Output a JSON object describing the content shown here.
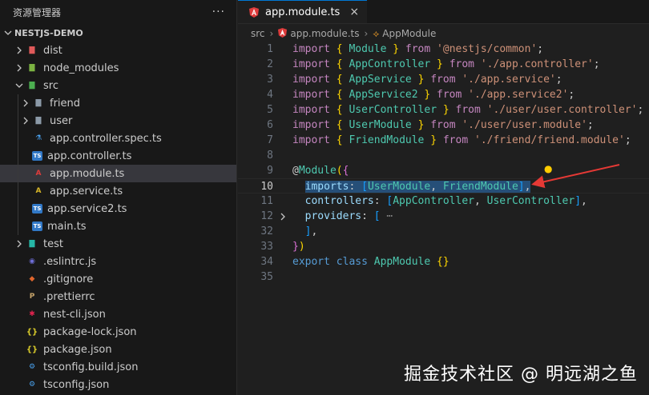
{
  "sidebar": {
    "title": "资源管理器",
    "more": "···",
    "project": "NESTJS-DEMO",
    "items": [
      {
        "label": "dist",
        "icon": "folder-dist-icon",
        "depth": 0,
        "chevron": "right",
        "glyph": "▇"
      },
      {
        "label": "node_modules",
        "icon": "folder-node-icon",
        "depth": 0,
        "chevron": "right",
        "glyph": "▇"
      },
      {
        "label": "src",
        "icon": "folder-src-icon",
        "depth": 0,
        "chevron": "down",
        "glyph": "▇"
      },
      {
        "label": "friend",
        "icon": "folder-icon",
        "depth": 1,
        "chevron": "right",
        "glyph": "▇"
      },
      {
        "label": "user",
        "icon": "folder-icon",
        "depth": 1,
        "chevron": "right",
        "glyph": "▇"
      },
      {
        "label": "app.controller.spec.ts",
        "icon": "test-flask-icon",
        "depth": 1,
        "chevron": "",
        "glyph": "⚗"
      },
      {
        "label": "app.controller.ts",
        "icon": "typescript-icon",
        "depth": 1,
        "chevron": "",
        "glyph": "TS"
      },
      {
        "label": "app.module.ts",
        "icon": "angular-icon",
        "depth": 1,
        "chevron": "",
        "glyph": "A",
        "selected": true
      },
      {
        "label": "app.service.ts",
        "icon": "angular-service-icon",
        "depth": 1,
        "chevron": "",
        "glyph": "A"
      },
      {
        "label": "app.service2.ts",
        "icon": "typescript-icon",
        "depth": 1,
        "chevron": "",
        "glyph": "TS"
      },
      {
        "label": "main.ts",
        "icon": "typescript-icon",
        "depth": 1,
        "chevron": "",
        "glyph": "TS"
      },
      {
        "label": "test",
        "icon": "folder-test-icon",
        "depth": 0,
        "chevron": "right",
        "glyph": "▇"
      },
      {
        "label": ".eslintrc.js",
        "icon": "eslint-icon",
        "depth": 0,
        "chevron": "",
        "glyph": "◉"
      },
      {
        "label": ".gitignore",
        "icon": "git-icon",
        "depth": 0,
        "chevron": "",
        "glyph": "◆"
      },
      {
        "label": ".prettierrc",
        "icon": "prettier-icon",
        "depth": 0,
        "chevron": "",
        "glyph": "P"
      },
      {
        "label": "nest-cli.json",
        "icon": "nest-icon",
        "depth": 0,
        "chevron": "",
        "glyph": "✱"
      },
      {
        "label": "package-lock.json",
        "icon": "json-icon",
        "depth": 0,
        "chevron": "",
        "glyph": "{}"
      },
      {
        "label": "package.json",
        "icon": "json-icon",
        "depth": 0,
        "chevron": "",
        "glyph": "{}"
      },
      {
        "label": "tsconfig.build.json",
        "icon": "tsconfig-icon",
        "depth": 0,
        "chevron": "",
        "glyph": "⚙"
      },
      {
        "label": "tsconfig.json",
        "icon": "tsconfig-icon",
        "depth": 0,
        "chevron": "",
        "glyph": "⚙"
      }
    ]
  },
  "editor": {
    "tab": {
      "label": "app.module.ts",
      "close": "×"
    },
    "breadcrumb": {
      "folder": "src",
      "file": "app.module.ts",
      "symbol": "AppModule"
    },
    "lines": [
      {
        "n": "1",
        "segs": [
          [
            "kw",
            "import"
          ],
          [
            "punc",
            " "
          ],
          [
            "br",
            "{"
          ],
          [
            "punc",
            " "
          ],
          [
            "id",
            "Module"
          ],
          [
            "punc",
            " "
          ],
          [
            "br",
            "}"
          ],
          [
            "punc",
            " "
          ],
          [
            "kw",
            "from"
          ],
          [
            "punc",
            " "
          ],
          [
            "str",
            "'@nestjs/common'"
          ],
          [
            "punc",
            ";"
          ]
        ]
      },
      {
        "n": "2",
        "segs": [
          [
            "kw",
            "import"
          ],
          [
            "punc",
            " "
          ],
          [
            "br",
            "{"
          ],
          [
            "punc",
            " "
          ],
          [
            "id",
            "AppController"
          ],
          [
            "punc",
            " "
          ],
          [
            "br",
            "}"
          ],
          [
            "punc",
            " "
          ],
          [
            "kw",
            "from"
          ],
          [
            "punc",
            " "
          ],
          [
            "str",
            "'./app.controller'"
          ],
          [
            "punc",
            ";"
          ]
        ]
      },
      {
        "n": "3",
        "segs": [
          [
            "kw",
            "import"
          ],
          [
            "punc",
            " "
          ],
          [
            "br",
            "{"
          ],
          [
            "punc",
            " "
          ],
          [
            "id",
            "AppService"
          ],
          [
            "punc",
            " "
          ],
          [
            "br",
            "}"
          ],
          [
            "punc",
            " "
          ],
          [
            "kw",
            "from"
          ],
          [
            "punc",
            " "
          ],
          [
            "str",
            "'./app.service'"
          ],
          [
            "punc",
            ";"
          ]
        ]
      },
      {
        "n": "4",
        "segs": [
          [
            "kw",
            "import"
          ],
          [
            "punc",
            " "
          ],
          [
            "br",
            "{"
          ],
          [
            "punc",
            " "
          ],
          [
            "id",
            "AppService2"
          ],
          [
            "punc",
            " "
          ],
          [
            "br",
            "}"
          ],
          [
            "punc",
            " "
          ],
          [
            "kw",
            "from"
          ],
          [
            "punc",
            " "
          ],
          [
            "str",
            "'./app.service2'"
          ],
          [
            "punc",
            ";"
          ]
        ]
      },
      {
        "n": "5",
        "segs": [
          [
            "kw",
            "import"
          ],
          [
            "punc",
            " "
          ],
          [
            "br",
            "{"
          ],
          [
            "punc",
            " "
          ],
          [
            "id",
            "UserController"
          ],
          [
            "punc",
            " "
          ],
          [
            "br",
            "}"
          ],
          [
            "punc",
            " "
          ],
          [
            "kw",
            "from"
          ],
          [
            "punc",
            " "
          ],
          [
            "str",
            "'./user/user.controller'"
          ],
          [
            "punc",
            ";"
          ]
        ]
      },
      {
        "n": "6",
        "segs": [
          [
            "kw",
            "import"
          ],
          [
            "punc",
            " "
          ],
          [
            "br",
            "{"
          ],
          [
            "punc",
            " "
          ],
          [
            "id",
            "UserModule"
          ],
          [
            "punc",
            " "
          ],
          [
            "br",
            "}"
          ],
          [
            "punc",
            " "
          ],
          [
            "kw",
            "from"
          ],
          [
            "punc",
            " "
          ],
          [
            "str",
            "'./user/user.module'"
          ],
          [
            "punc",
            ";"
          ]
        ]
      },
      {
        "n": "7",
        "segs": [
          [
            "kw",
            "import"
          ],
          [
            "punc",
            " "
          ],
          [
            "br",
            "{"
          ],
          [
            "punc",
            " "
          ],
          [
            "id",
            "FriendModule"
          ],
          [
            "punc",
            " "
          ],
          [
            "br",
            "}"
          ],
          [
            "punc",
            " "
          ],
          [
            "kw",
            "from"
          ],
          [
            "punc",
            " "
          ],
          [
            "str",
            "'./friend/friend.module'"
          ],
          [
            "punc",
            ";"
          ]
        ]
      },
      {
        "n": "8",
        "segs": []
      },
      {
        "n": "9",
        "segs": [
          [
            "punc",
            "@"
          ],
          [
            "id",
            "Module"
          ],
          [
            "br",
            "("
          ],
          [
            "br2",
            "{"
          ]
        ]
      },
      {
        "n": "10",
        "current": true,
        "segs": [
          [
            "punc",
            "  "
          ],
          [
            "var sel",
            "imports"
          ],
          [
            "punc sel",
            ": "
          ],
          [
            "br3 sel",
            "["
          ],
          [
            "id sel",
            "UserModule"
          ],
          [
            "punc sel",
            ", "
          ],
          [
            "id sel",
            "FriendModule"
          ],
          [
            "br3 sel",
            "]"
          ],
          [
            "punc sel",
            ","
          ]
        ]
      },
      {
        "n": "11",
        "segs": [
          [
            "punc",
            "  "
          ],
          [
            "var",
            "controllers"
          ],
          [
            "punc",
            ": "
          ],
          [
            "br3",
            "["
          ],
          [
            "id",
            "AppController"
          ],
          [
            "punc",
            ", "
          ],
          [
            "id",
            "UserController"
          ],
          [
            "br3",
            "]"
          ],
          [
            "punc",
            ","
          ]
        ]
      },
      {
        "n": "12",
        "fold": true,
        "segs": [
          [
            "punc",
            "  "
          ],
          [
            "var",
            "providers"
          ],
          [
            "punc",
            ": "
          ],
          [
            "br3",
            "["
          ],
          [
            "punc",
            " "
          ],
          [
            "ellip",
            "⋯"
          ]
        ]
      },
      {
        "n": "32",
        "segs": [
          [
            "punc",
            "  "
          ],
          [
            "br3",
            "]"
          ],
          [
            "punc",
            ","
          ]
        ]
      },
      {
        "n": "33",
        "segs": [
          [
            "br2",
            "}"
          ],
          [
            "br",
            ")"
          ]
        ]
      },
      {
        "n": "34",
        "segs": [
          [
            "kw2",
            "export"
          ],
          [
            "punc",
            " "
          ],
          [
            "kw2",
            "class"
          ],
          [
            "punc",
            " "
          ],
          [
            "id",
            "AppModule"
          ],
          [
            "punc",
            " "
          ],
          [
            "br",
            "{}"
          ]
        ]
      },
      {
        "n": "35",
        "segs": []
      }
    ]
  },
  "watermark": "掘金技术社区 @ 明远湖之鱼",
  "colors": {
    "accent": "#0078d4",
    "selection": "#264f78",
    "arrow": "#e53935"
  }
}
